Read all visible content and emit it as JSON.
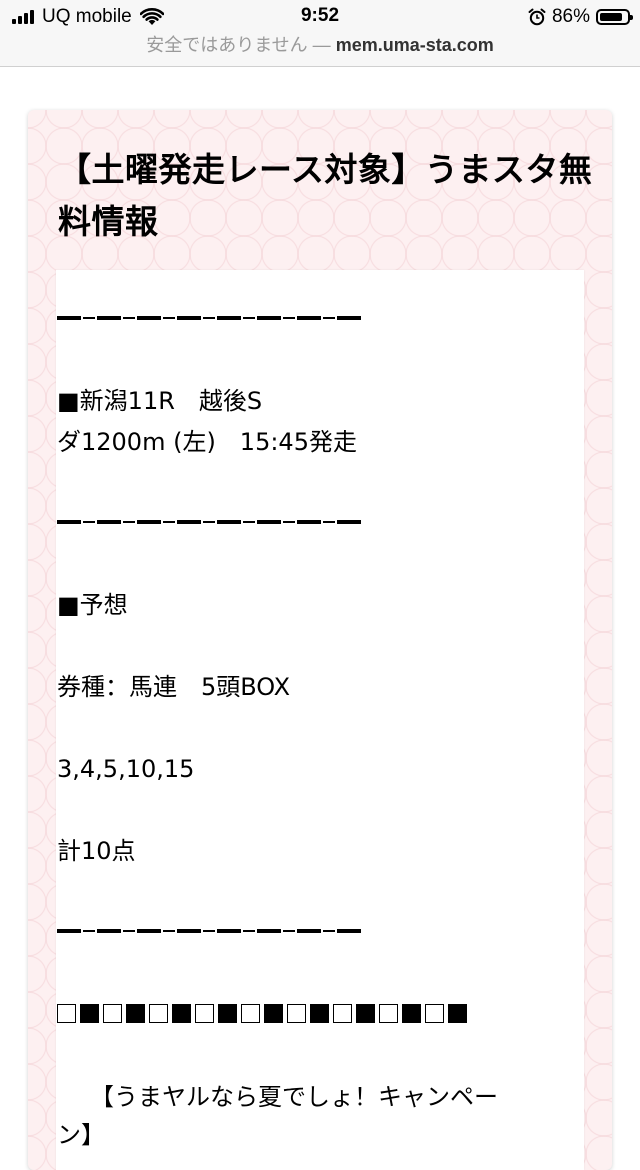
{
  "status_bar": {
    "carrier": "UQ mobile",
    "time": "9:52",
    "battery_percent": "86%",
    "battery_level": 0.86
  },
  "url_bar": {
    "insecure_label": "安全ではありません —",
    "domain": "mem.uma-sta.com"
  },
  "article": {
    "title": "【土曜発走レース対象】うまスタ無料情報",
    "race_header": "■新潟11R　越後S",
    "race_detail": "ダ1200m (左)　15:45発走",
    "prediction_label": "■予想",
    "ticket_type": "券種：馬連　5頭BOX",
    "numbers": "3,4,5,10,15",
    "total_points": "計10点",
    "campaign_line1": "【うまヤルなら夏でしょ！キャンペー",
    "campaign_line2": "ン】"
  },
  "accent_colors": {
    "card_background": "#fdf0f1",
    "pattern": "#f0c8cd"
  }
}
